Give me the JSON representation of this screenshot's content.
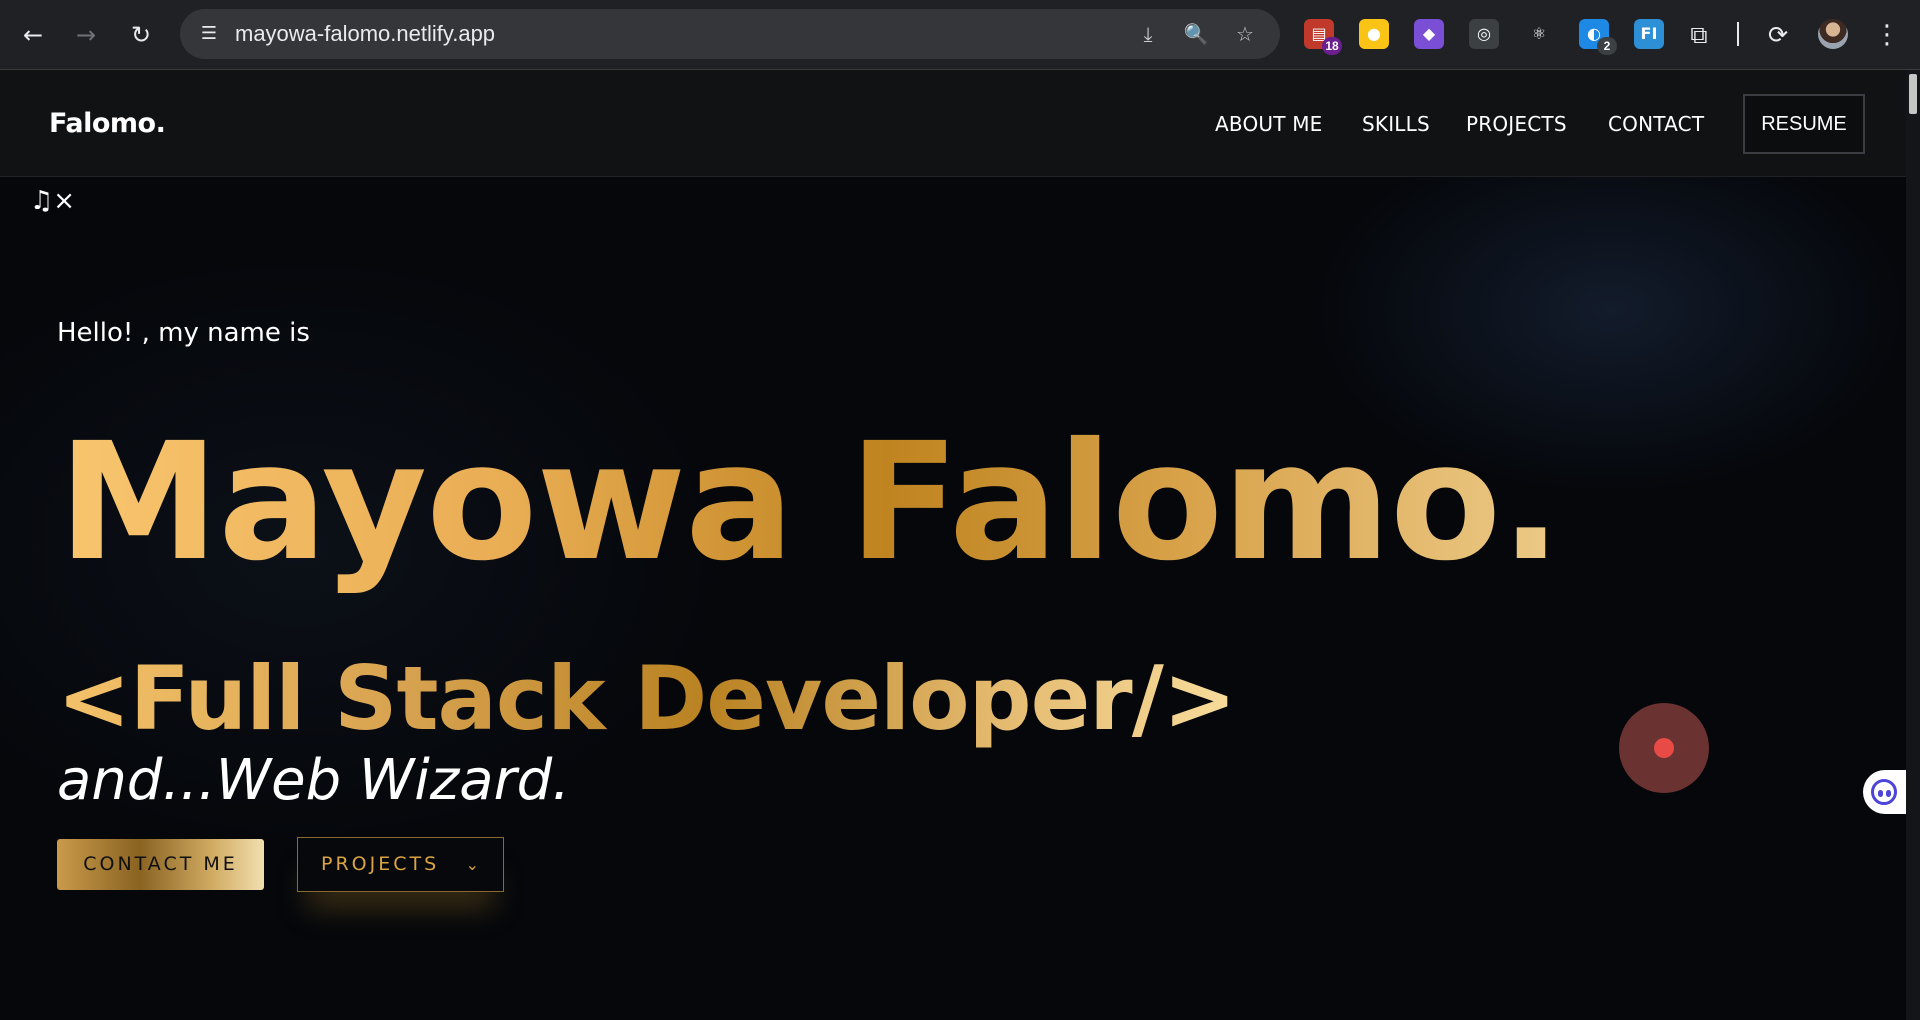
{
  "browser": {
    "url": "mayowa-falomo.netlify.app",
    "icons": {
      "back": "←",
      "forward": "→",
      "reload": "↻",
      "site_info": "☰",
      "install": "⤓",
      "zoom": "🔍",
      "bookmark": "☆",
      "extensions": "⧉",
      "menu": "⋮"
    },
    "extensions": [
      {
        "name": "tabs-extension",
        "glyph": "▤",
        "badge": "18",
        "color": "#c0392b"
      },
      {
        "name": "keep-extension",
        "glyph": "●",
        "badge": "",
        "color": "#f9c416"
      },
      {
        "name": "color-picker-extension",
        "glyph": "◆",
        "badge": "",
        "color": "#7a4fd6"
      },
      {
        "name": "lightbulb-extension",
        "glyph": "◎",
        "badge": "",
        "color": "#3c4043"
      },
      {
        "name": "react-devtools-extension",
        "glyph": "⚛",
        "badge": "",
        "color": "#202124"
      },
      {
        "name": "ghost-extension",
        "glyph": "◐",
        "badge": "2",
        "color": "#1e88e5"
      },
      {
        "name": "fi-extension",
        "glyph": "FI",
        "badge": "",
        "color": "#2d8fd5"
      }
    ]
  },
  "site": {
    "logo": "Falomo.",
    "nav": [
      "ABOUT ME",
      "SKILLS",
      "PROJECTS",
      "CONTACT"
    ],
    "resume": "RESUME",
    "music_icon": "♫×"
  },
  "hero": {
    "greeting": "Hello! , my name is",
    "name": "Mayowa Falomo.",
    "role": "<Full Stack Developer/>",
    "tagline": "and...Web Wizard.",
    "contact_button": "CONTACT ME",
    "projects_button": "PROJECTS",
    "projects_chevron": "⌄"
  },
  "colors": {
    "gold_accent": "#d9a441",
    "record_button": "#6b3232",
    "record_dot": "#e84a45"
  }
}
